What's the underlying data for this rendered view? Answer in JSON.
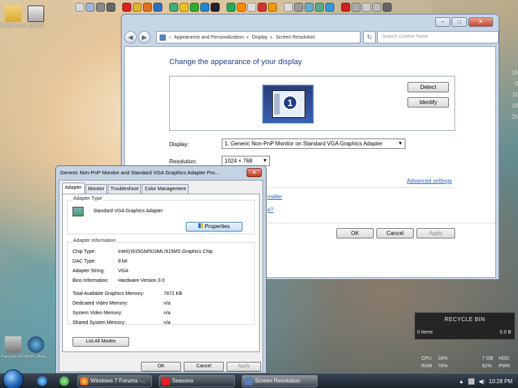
{
  "desktop": {
    "icons_top": [
      {
        "label": "WWCM v1.0"
      },
      {
        "label": "Untitled"
      }
    ],
    "icons_bottom": [
      {
        "label": "Recycle Bin"
      },
      {
        "label": "MSN MAIL"
      }
    ],
    "calendar_numbers": [
      "18",
      "0",
      "11",
      "18",
      "25"
    ]
  },
  "window": {
    "breadcrumb": [
      "Appearance and Personalization",
      "Display",
      "Screen Resolution"
    ],
    "search_placeholder": "Search Control Panel",
    "heading": "Change the appearance of your display",
    "monitor_number": "1",
    "detect_label": "Detect",
    "identify_label": "Identify",
    "display_label": "Display:",
    "display_value": "1. Generic Non-PnP Monitor on Standard VGA Graphics Adapter",
    "resolution_label": "Resolution:",
    "resolution_value": "1024 × 768",
    "advanced_link": "Advanced settings",
    "partial_link_1": "maller",
    "partial_link_2": "e?",
    "ok_label": "OK",
    "cancel_label": "Cancel",
    "apply_label": "Apply"
  },
  "dialog": {
    "title": "Generic Non-PnP Monitor and Standard VGA Graphics Adapter Pro...",
    "tabs": [
      "Adapter",
      "Monitor",
      "Troubleshoot",
      "Color Management"
    ],
    "adapter_type_label": "Adapter Type",
    "adapter_name": "Standard VGA Graphics Adapter",
    "properties_label": "Properties",
    "adapter_info_label": "Adapter Information",
    "info_rows": [
      {
        "key": "Chip Type:",
        "value": "Intel(r)915GM/910ML/915MS Graphics Chip"
      },
      {
        "key": "DAC Type:",
        "value": "8 bit"
      },
      {
        "key": "Adapter String:",
        "value": "VGA"
      },
      {
        "key": "Bios Information:",
        "value": "Hardware Version 0.0"
      }
    ],
    "memory_rows": [
      {
        "key": "Total Available Graphics Memory:",
        "value": "7872 KB"
      },
      {
        "key": "Dedicated Video Memory:",
        "value": "n/a"
      },
      {
        "key": "System Video Memory:",
        "value": "n/a"
      },
      {
        "key": "Shared System Memory:",
        "value": "n/a"
      }
    ],
    "list_all_modes_label": "List All Modes",
    "ok_label": "OK",
    "cancel_label": "Cancel",
    "apply_label": "Apply"
  },
  "recycle_gadget": {
    "title": "RECYCLE BIN",
    "items": "0 items",
    "size": "0.0 B"
  },
  "system_meter": {
    "cpu_label": "CPU",
    "cpu_value": "18%",
    "ram_label": "RAM",
    "ram_value": "76%",
    "hdd_size": "7 GB",
    "hdd_label": "HDD",
    "pwr_value": "82%",
    "pwr_label": "PWR"
  },
  "taskbar": {
    "buttons": [
      {
        "label": "Windows 7 Forums -..."
      },
      {
        "label": "Seasons"
      },
      {
        "label": "Screen Resolution"
      }
    ],
    "clock": "10:28 PM"
  },
  "colors": {
    "heading_blue": "#1e3d87",
    "link_blue": "#1f5fbf",
    "close_red": "#c8452e"
  }
}
